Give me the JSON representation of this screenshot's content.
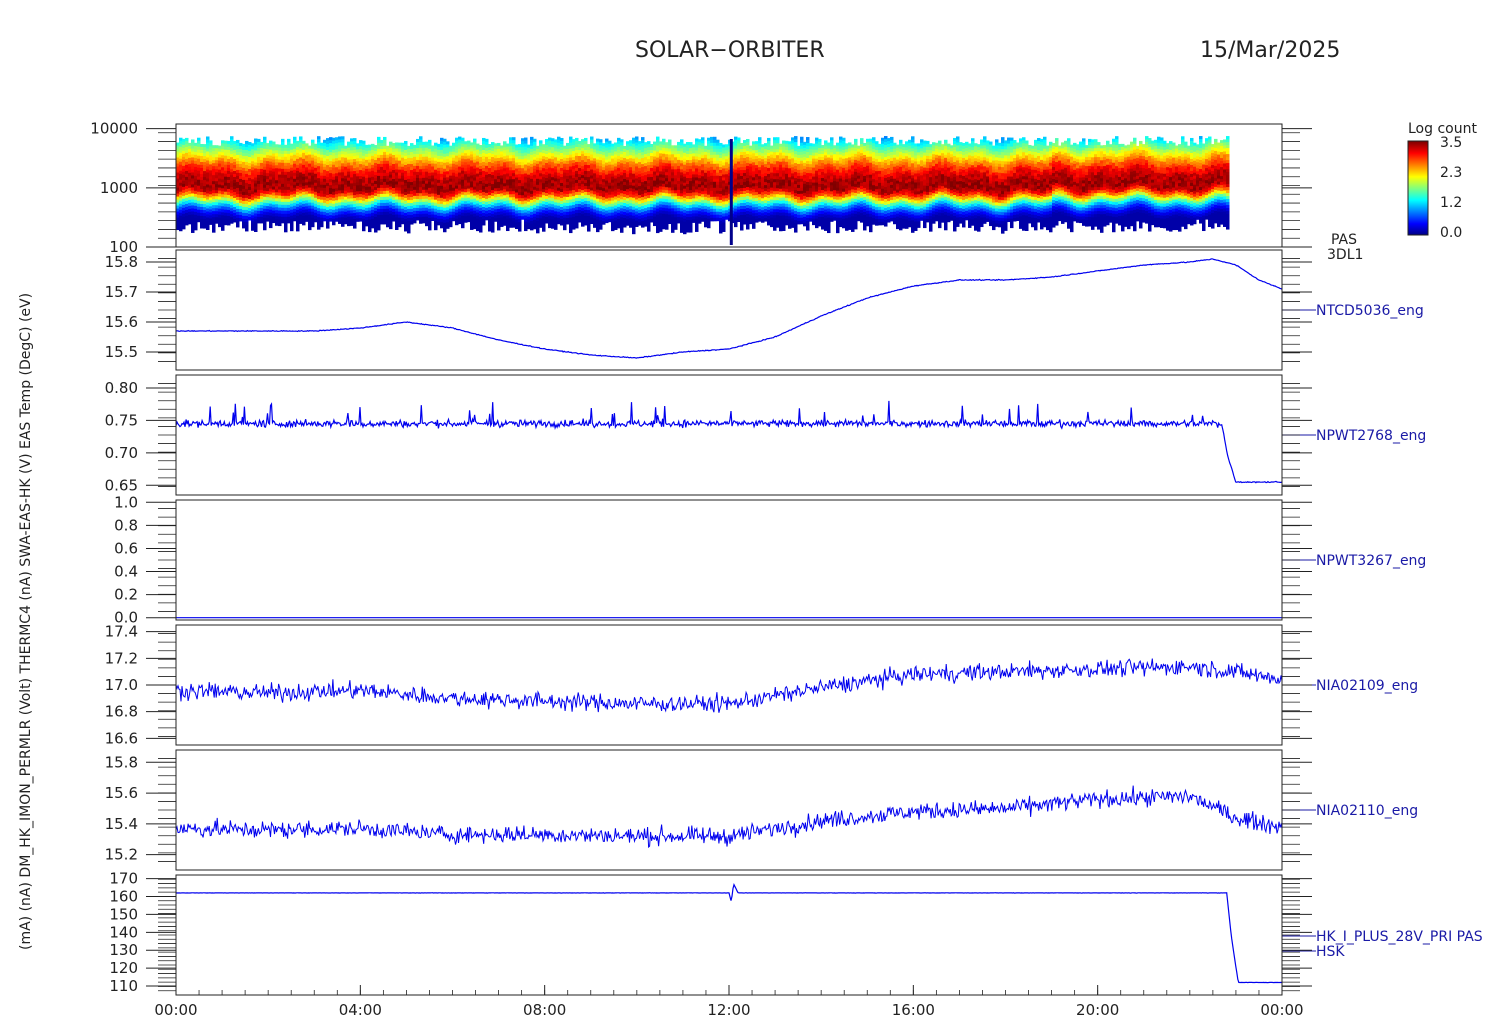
{
  "header": {
    "title": "SOLAR−ORBITER",
    "date": "15/Mar/2025"
  },
  "y_axis_overlap_label": "(mA) (nA) DM_HK_IMON_PERMLR (Volt) THERMC4 (nA) SWA-EAS-HK (V) EAS Temp (DegC) (eV)",
  "colors": {
    "trace": "#0000ee",
    "label": "#1a1aa6",
    "axis": "#222222"
  },
  "chart_data": [
    {
      "type": "heatmap",
      "name": "PAS 3DL1",
      "right_label": [
        "PAS",
        "3DL1"
      ],
      "yscale": "log",
      "ylim": [
        100,
        12000
      ],
      "yticks": [
        "10000",
        "1000",
        "100"
      ],
      "ytick_values": [
        10000,
        1000,
        100
      ],
      "colorbar": {
        "label": "Log count",
        "ticks": [
          "3.5",
          "2.3",
          "1.2",
          "0.0"
        ],
        "range": [
          0.0,
          3.5
        ]
      },
      "data_extent_hours": [
        0,
        22.8
      ],
      "peak_energy_eV": 1100,
      "notes": "energy band peaks near 1000 eV; data gap after ~22:48"
    },
    {
      "type": "line",
      "right_label": "NTCD5036_eng",
      "ylim": [
        15.44,
        15.84
      ],
      "yticks": [
        "15.8",
        "15.7",
        "15.6",
        "15.5"
      ],
      "ytick_values": [
        15.8,
        15.7,
        15.6,
        15.5
      ],
      "x_hours": [
        0,
        1,
        2,
        3,
        4,
        5,
        6,
        7,
        8,
        9,
        10,
        11,
        12,
        13,
        14,
        15,
        16,
        17,
        18,
        19,
        20,
        21,
        22,
        22.5,
        23,
        23.5,
        24
      ],
      "values": [
        15.57,
        15.57,
        15.57,
        15.57,
        15.58,
        15.6,
        15.58,
        15.54,
        15.51,
        15.49,
        15.48,
        15.5,
        15.51,
        15.55,
        15.62,
        15.68,
        15.72,
        15.74,
        15.74,
        15.75,
        15.77,
        15.79,
        15.8,
        15.81,
        15.79,
        15.74,
        15.71
      ]
    },
    {
      "type": "line",
      "right_label": "NPWT2768_eng",
      "ylim": [
        0.635,
        0.82
      ],
      "yticks": [
        "0.80",
        "0.75",
        "0.70",
        "0.65"
      ],
      "ytick_values": [
        0.8,
        0.75,
        0.7,
        0.65
      ],
      "x_hours": [
        0,
        4,
        8,
        12,
        16,
        20,
        22.7,
        22.8,
        23.0,
        24
      ],
      "values": [
        0.745,
        0.745,
        0.745,
        0.745,
        0.745,
        0.745,
        0.745,
        0.7,
        0.655,
        0.655
      ],
      "notes": "noisy signal, spikes up to ~0.80"
    },
    {
      "type": "line",
      "right_label": "NPWT3267_eng",
      "ylim": [
        -0.02,
        1.02
      ],
      "yticks": [
        "1.0",
        "0.8",
        "0.6",
        "0.4",
        "0.2",
        "0.0"
      ],
      "ytick_values": [
        1.0,
        0.8,
        0.6,
        0.4,
        0.2,
        0.0
      ],
      "x_hours": [
        0,
        24
      ],
      "values": [
        0.0,
        0.0
      ]
    },
    {
      "type": "line",
      "right_label": "NIA02109_eng",
      "ylim": [
        16.55,
        17.45
      ],
      "yticks": [
        "17.4",
        "17.2",
        "17.0",
        "16.8",
        "16.6"
      ],
      "ytick_values": [
        17.4,
        17.2,
        17.0,
        16.8,
        16.6
      ],
      "x_hours": [
        0,
        2,
        4,
        6,
        8,
        10,
        12,
        14,
        16,
        18,
        20,
        22,
        23,
        24
      ],
      "values": [
        16.96,
        16.94,
        16.96,
        16.9,
        16.88,
        16.86,
        16.86,
        16.98,
        17.08,
        17.1,
        17.12,
        17.14,
        17.1,
        17.04
      ],
      "notes": "quantized noisy signal"
    },
    {
      "type": "line",
      "right_label": "NIA02110_eng",
      "ylim": [
        15.1,
        15.88
      ],
      "yticks": [
        "15.8",
        "15.6",
        "15.4",
        "15.2"
      ],
      "ytick_values": [
        15.8,
        15.6,
        15.4,
        15.2
      ],
      "x_hours": [
        0,
        2,
        4,
        6,
        8,
        10,
        12,
        14,
        16,
        18,
        20,
        22,
        23,
        24
      ],
      "values": [
        15.37,
        15.36,
        15.37,
        15.33,
        15.33,
        15.32,
        15.32,
        15.42,
        15.48,
        15.5,
        15.56,
        15.58,
        15.44,
        15.38
      ],
      "notes": "quantized noisy signal"
    },
    {
      "type": "line",
      "right_label": [
        "HK_I_PLUS_28V_PRI PAS",
        "HSK"
      ],
      "ylim": [
        105,
        172
      ],
      "yticks": [
        "170",
        "160",
        "150",
        "140",
        "130",
        "120",
        "110"
      ],
      "ytick_values": [
        170,
        160,
        150,
        140,
        130,
        120,
        110
      ],
      "x_hours": [
        0,
        12.0,
        12.05,
        12.1,
        12.2,
        22.8,
        22.9,
        23.05,
        24
      ],
      "values": [
        162,
        162,
        157,
        167,
        162,
        162,
        138,
        112,
        112
      ]
    }
  ],
  "x_axis": {
    "ticks": [
      "00:00",
      "04:00",
      "08:00",
      "12:00",
      "16:00",
      "20:00",
      "00:00"
    ],
    "range_hours": [
      0,
      24
    ]
  }
}
